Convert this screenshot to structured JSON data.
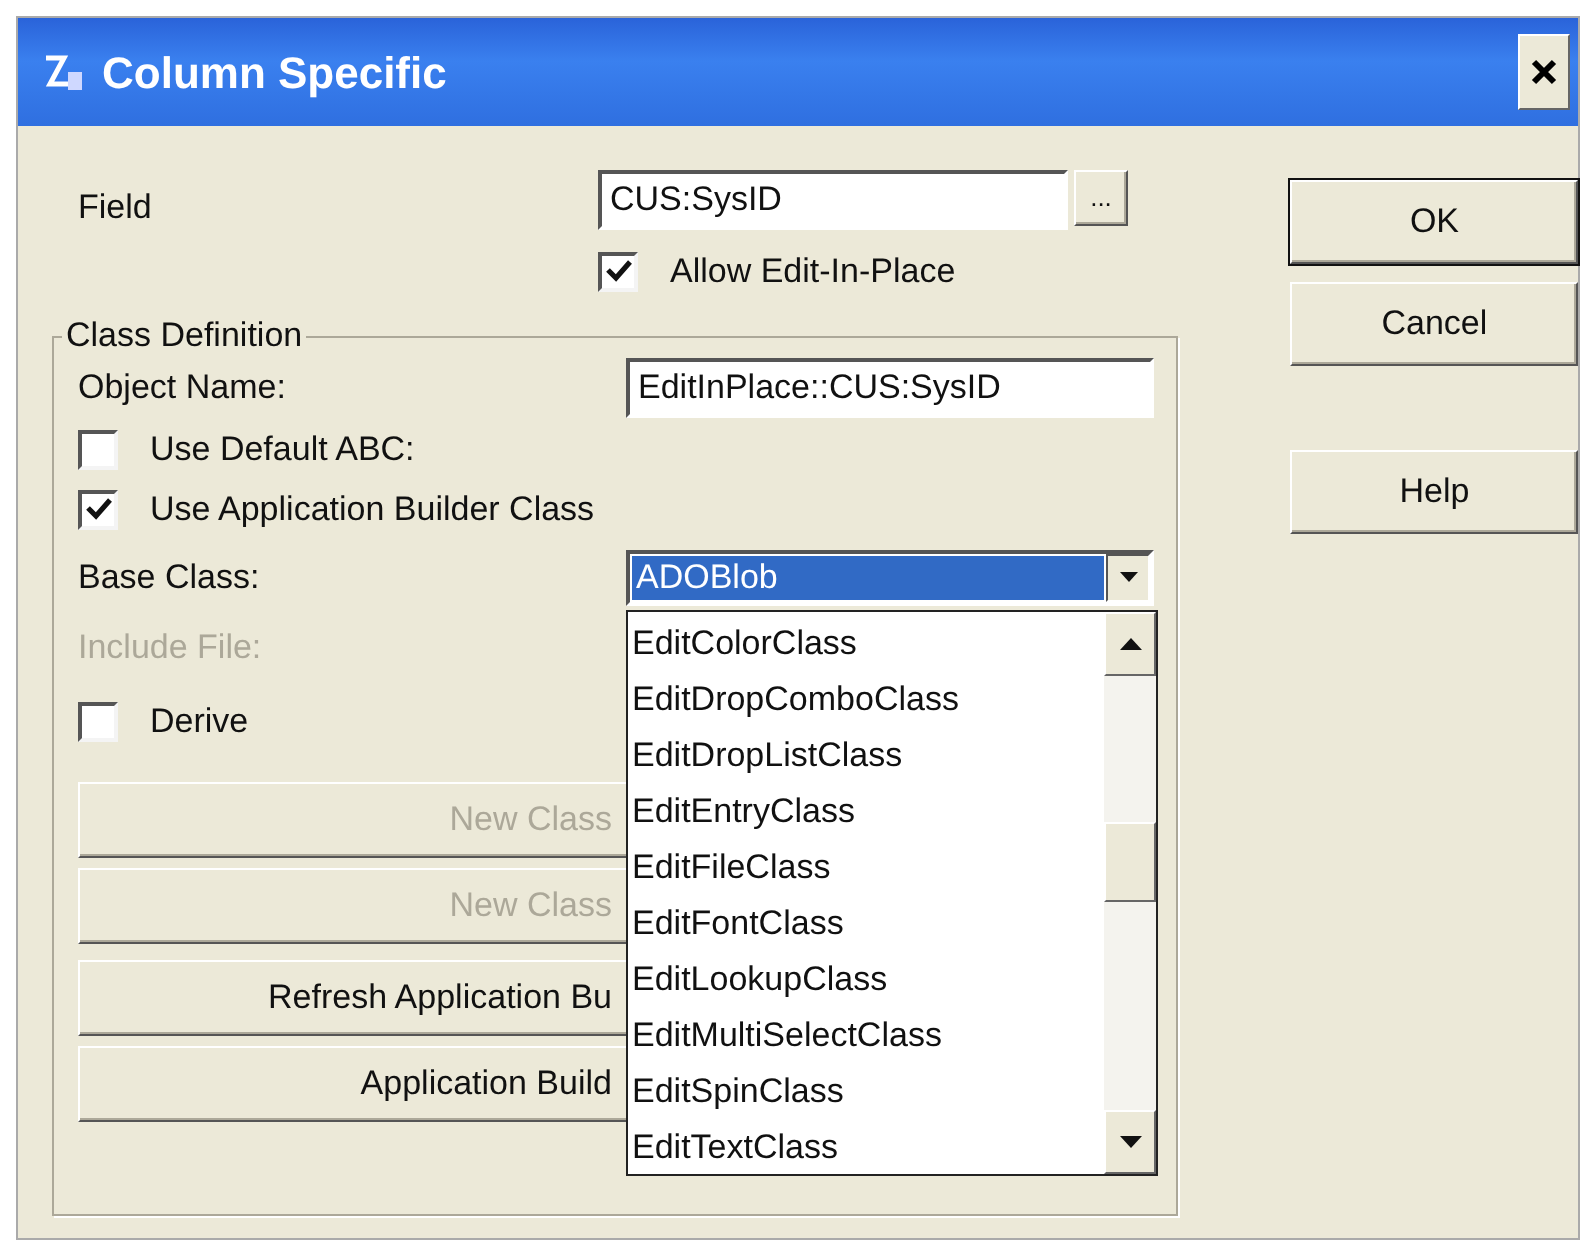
{
  "window": {
    "title": "Column Specific"
  },
  "field": {
    "label": "Field",
    "value": "CUS:SysID",
    "browse_button": "..."
  },
  "allow_edit_in_place": {
    "label": "Allow Edit-In-Place",
    "checked": true
  },
  "class_definition": {
    "title": "Class Definition",
    "object_name": {
      "label": "Object Name:",
      "value": "EditInPlace::CUS:SysID"
    },
    "options": [
      {
        "label": "Use Default ABC:",
        "checked": false
      },
      {
        "label": "Use Application Builder Class",
        "checked": true
      }
    ],
    "base_class": {
      "label": "Base Class:",
      "value": "ADOBlob",
      "expanded": true,
      "items": [
        "EditColorClass",
        "EditDropComboClass",
        "EditDropListClass",
        "EditEntryClass",
        "EditFileClass",
        "EditFontClass",
        "EditLookupClass",
        "EditMultiSelectClass",
        "EditSpinClass",
        "EditTextClass"
      ]
    },
    "include_file": {
      "label": "Include File:",
      "disabled": true
    },
    "derive": {
      "label": "Derive",
      "checked": false
    },
    "buttons": [
      {
        "label": "New Class",
        "disabled": true
      },
      {
        "label": "New Class",
        "disabled": true
      },
      {
        "label": "Refresh Application Bu",
        "disabled": false
      },
      {
        "label": "Application Build",
        "disabled": false
      }
    ]
  },
  "dialog_buttons": [
    {
      "label": "OK",
      "default": true
    },
    {
      "label": "Cancel",
      "default": false
    },
    {
      "label": "Help",
      "default": false
    }
  ]
}
